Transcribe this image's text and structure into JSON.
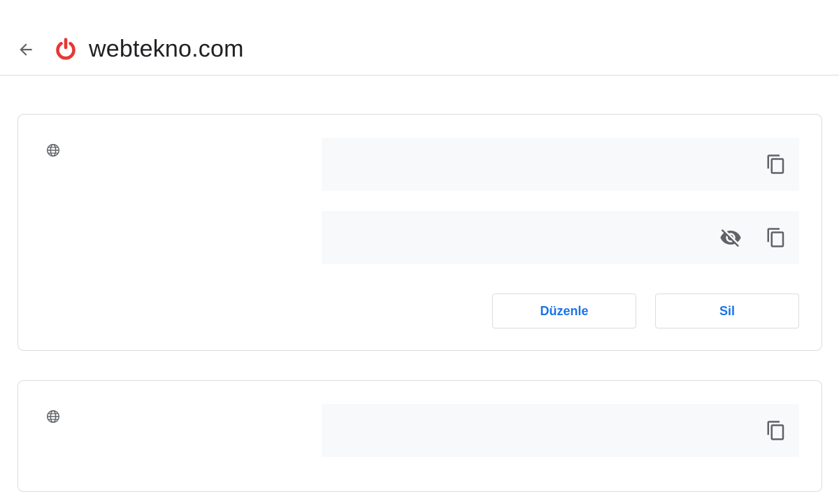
{
  "header": {
    "back_icon": "arrow-left-icon",
    "site_icon": "power-icon",
    "site_title": "webtekno.com",
    "accent_color": "#e53935"
  },
  "cards": [
    {
      "site_icon": "globe-icon",
      "username_value": "",
      "password_value": "",
      "copy_icon": "copy-icon",
      "visibility_icon": "eye-off-icon",
      "edit_label": "Düzenle",
      "delete_label": "Sil"
    },
    {
      "site_icon": "globe-icon",
      "username_value": "",
      "copy_icon": "copy-icon"
    }
  ],
  "colors": {
    "link_blue": "#1a73e8",
    "border": "#dadce0",
    "field_bg": "#f8f9fa",
    "icon_gray": "#5f6368"
  }
}
